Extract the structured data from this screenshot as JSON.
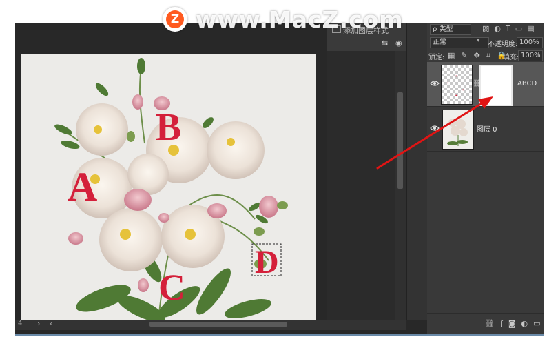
{
  "watermark": {
    "logo_letter": "Z",
    "text": "www.MacZ.com"
  },
  "canvas": {
    "letters": [
      "A",
      "B",
      "C",
      "D"
    ]
  },
  "upper_panel": {
    "add_style_label": "添加图层样式"
  },
  "layers_panel": {
    "filter_value": "类型",
    "blend_mode": "正常",
    "opacity_label": "不透明度:",
    "opacity_value": "100%",
    "lock_label": "锁定:",
    "fill_label": "填充:",
    "fill_value": "100%",
    "layers": [
      {
        "name": "ABCD",
        "selected": true,
        "has_mask": true
      },
      {
        "name": "图层 0",
        "selected": false,
        "has_mask": false
      }
    ]
  },
  "status": {
    "left_text": "4"
  },
  "colors": {
    "ui_dark": "#282828",
    "panel": "#393939",
    "selected_layer": "#575757",
    "letter_red": "#d4203a",
    "arrow_red": "#e01414",
    "watermark_orange": "#ff5a1f"
  }
}
